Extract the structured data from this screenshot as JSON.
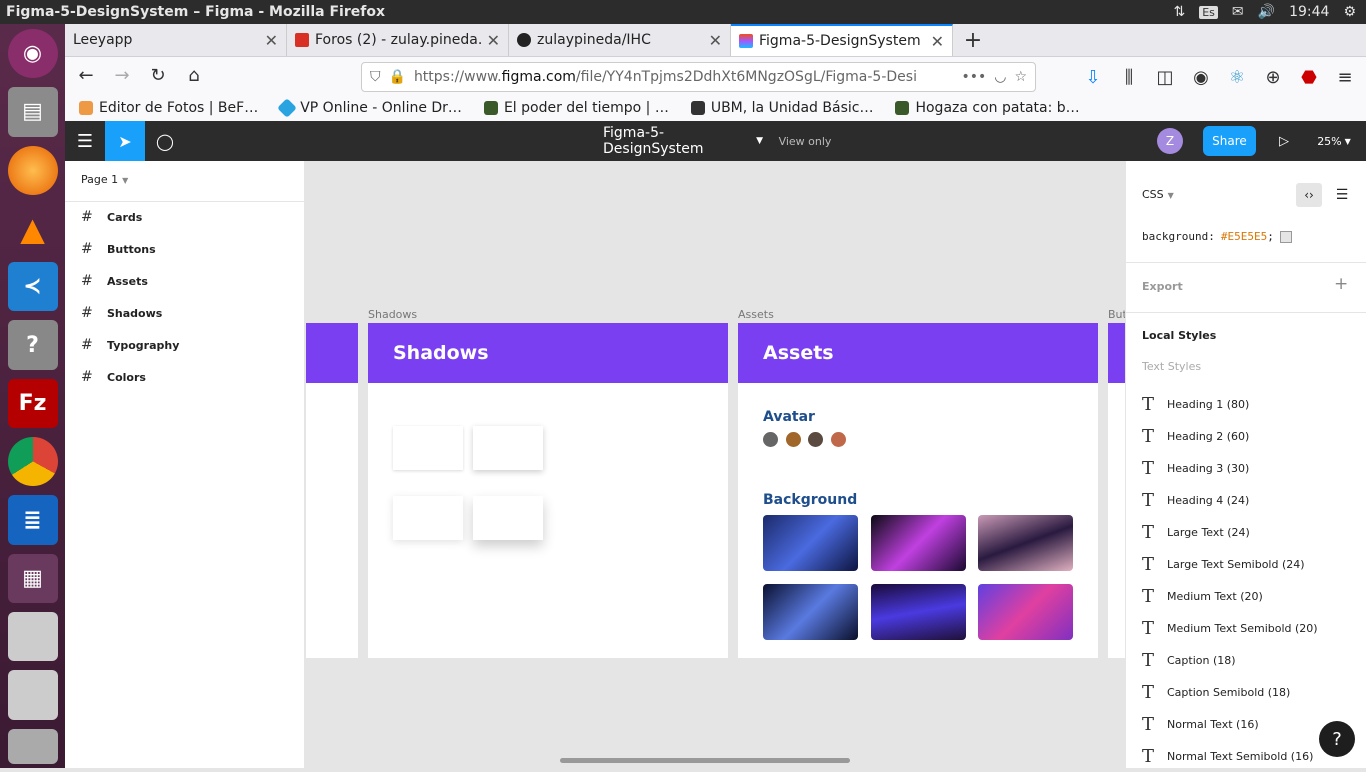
{
  "window_title": "Figma-5-DesignSystem – Figma - Mozilla Firefox",
  "tray": {
    "keyboard": "Es",
    "time": "19:44"
  },
  "tabs": [
    {
      "label": "Leeyapp",
      "icon": "none"
    },
    {
      "label": "Foros (2) - zulay.pineda.",
      "icon": "gmail-icon"
    },
    {
      "label": "zulaypineda/IHC",
      "icon": "github-icon"
    },
    {
      "label": "Figma-5-DesignSystem -",
      "icon": "figma-icon"
    }
  ],
  "url": {
    "prefix": "https://www.",
    "domain": "figma.com",
    "path": "/file/YY4nTpjms2DdhXt6MNgzOSgL/Figma-5-Desi"
  },
  "bookmarks": [
    "Editor de Fotos | BeF…",
    "VP Online - Online Dr…",
    "El poder del tiempo | …",
    "UBM, la Unidad Básic…",
    "Hogaza con patata: b…"
  ],
  "figma": {
    "file_name": "Figma-5-DesignSystem",
    "view_mode": "View only",
    "avatar_initial": "Z",
    "share_label": "Share",
    "zoom": "25%"
  },
  "left_panel": {
    "page": "Page 1",
    "layers": [
      "Cards",
      "Buttons",
      "Assets",
      "Shadows",
      "Typography",
      "Colors"
    ]
  },
  "canvas": {
    "shadows_label": "Shadows",
    "shadows_title": "Shadows",
    "assets_label": "Assets",
    "assets_title": "Assets",
    "avatar_heading": "Avatar",
    "background_heading": "Background",
    "buttons_label": "Butt"
  },
  "right_panel": {
    "code_lang": "CSS",
    "css_property": "background:",
    "css_value": "#E5E5E5",
    "css_semicolon": ";",
    "export_label": "Export",
    "local_styles": "Local Styles",
    "text_styles": "Text Styles",
    "styles": [
      "Heading 1 (80)",
      "Heading 2 (60)",
      "Heading 3 (30)",
      "Heading 4 (24)",
      "Large Text (24)",
      "Large Text Semibold (24)",
      "Medium Text (20)",
      "Medium Text Semibold (20)",
      "Caption (18)",
      "Caption Semibold (18)",
      "Normal Text (16)",
      "Normal Text Semibold (16)"
    ]
  },
  "colors": {
    "accent": "#7B3FF2",
    "share": "#0D99FF",
    "heading_blue": "#1E4E8C"
  }
}
